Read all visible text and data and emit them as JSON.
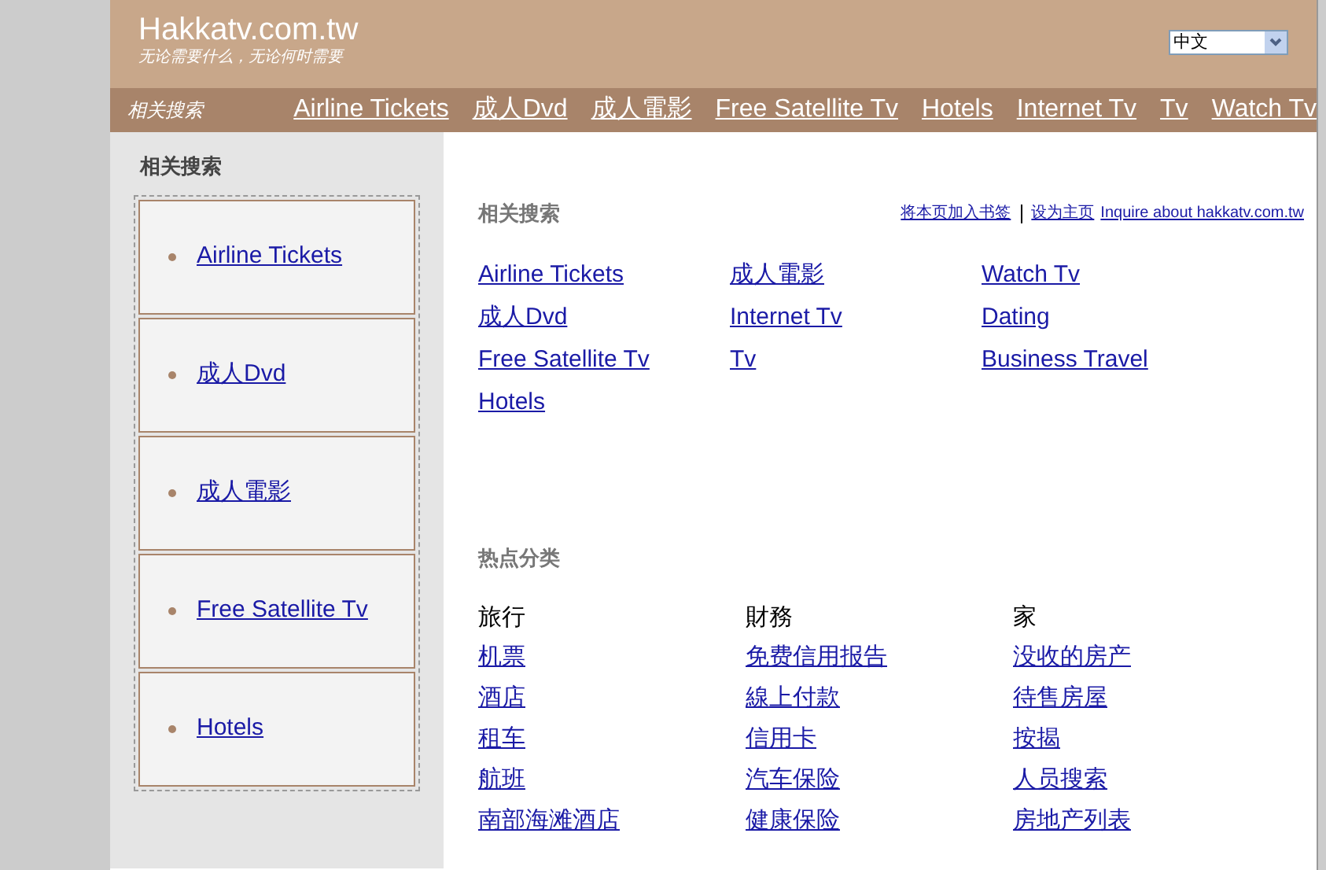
{
  "header": {
    "site_title": "Hakkatv.com.tw",
    "tagline": "无论需要什么，无论何时需要",
    "language_select": {
      "value": "中文"
    }
  },
  "nav_bar": {
    "label": "相关搜索",
    "links": [
      "Airline Tickets",
      "成人Dvd",
      "成人電影",
      "Free Satellite Tv",
      "Hotels",
      "Internet Tv",
      "Tv",
      "Watch Tv"
    ]
  },
  "sidebar": {
    "title": "相关搜索",
    "items": [
      "Airline Tickets",
      "成人Dvd",
      "成人電影",
      "Free Satellite Tv",
      "Hotels"
    ]
  },
  "related": {
    "title": "相关搜索",
    "top_links": [
      "将本页加入书签",
      "设为主页",
      "Inquire about hakkatv.com.tw"
    ],
    "columns": [
      [
        "Airline Tickets",
        "成人Dvd",
        "Free Satellite Tv",
        "Hotels"
      ],
      [
        "成人電影",
        "Internet Tv",
        "Tv"
      ],
      [
        "Watch Tv",
        "Dating",
        "Business Travel"
      ]
    ]
  },
  "hot_categories": {
    "title": "热点分类",
    "columns": [
      {
        "heading": "旅行",
        "links": [
          "机票",
          "酒店",
          "租车",
          "航班",
          "南部海滩酒店"
        ]
      },
      {
        "heading": "財務",
        "links": [
          "免费信用报告",
          "線上付款",
          "信用卡",
          "汽车保险",
          "健康保险"
        ]
      },
      {
        "heading": "家",
        "links": [
          "没收的房产",
          "待售房屋",
          "按揭",
          "人员搜索",
          "房地产列表"
        ]
      }
    ]
  }
}
